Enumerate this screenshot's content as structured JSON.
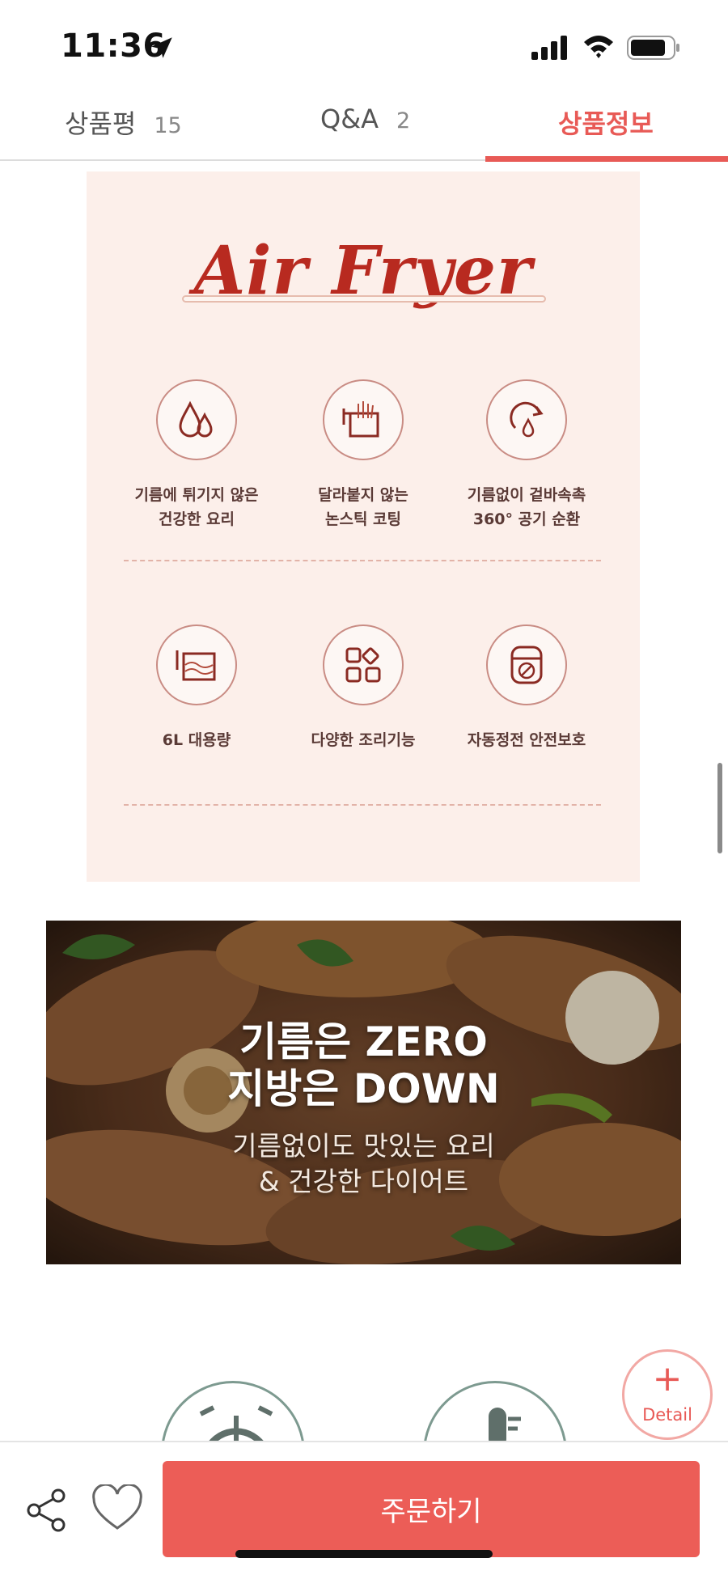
{
  "status_bar": {
    "time": "11:36"
  },
  "tabs": [
    {
      "label": "상품평",
      "count": "15",
      "active": false
    },
    {
      "label": "Q&A",
      "count": "2",
      "active": false
    },
    {
      "label": "상품정보",
      "count": "",
      "active": true
    }
  ],
  "product_info": {
    "title": "Air Fryer",
    "features": [
      {
        "icon": "oil-drops-icon",
        "label": "기름에 튀기지 않은\n건강한 요리"
      },
      {
        "icon": "fries-basket-icon",
        "label": "달라붙지 않는\n논스틱 코팅"
      },
      {
        "icon": "hot-air-circulation-icon",
        "label": "기름없이 겉바속촉\n360° 공기 순환"
      },
      {
        "icon": "capacity-basket-icon",
        "label": "6L 대용량"
      },
      {
        "icon": "cooking-modes-icon",
        "label": "다양한 조리기능"
      },
      {
        "icon": "auto-shutoff-icon",
        "label": "자동정전 안전보호"
      }
    ]
  },
  "banner": {
    "headline_1": "기름은 ZERO",
    "headline_2": "지방은 DOWN",
    "sub_1": "기름없이도 맛있는 요리",
    "sub_2": "& 건강한 다이어트"
  },
  "detail_fab": {
    "plus": "+",
    "label": "Detail"
  },
  "bottom_bar": {
    "order_label": "주문하기"
  },
  "colors": {
    "accent": "#ec5d57",
    "card_bg": "#fcefea",
    "title_red": "#b82a20"
  }
}
